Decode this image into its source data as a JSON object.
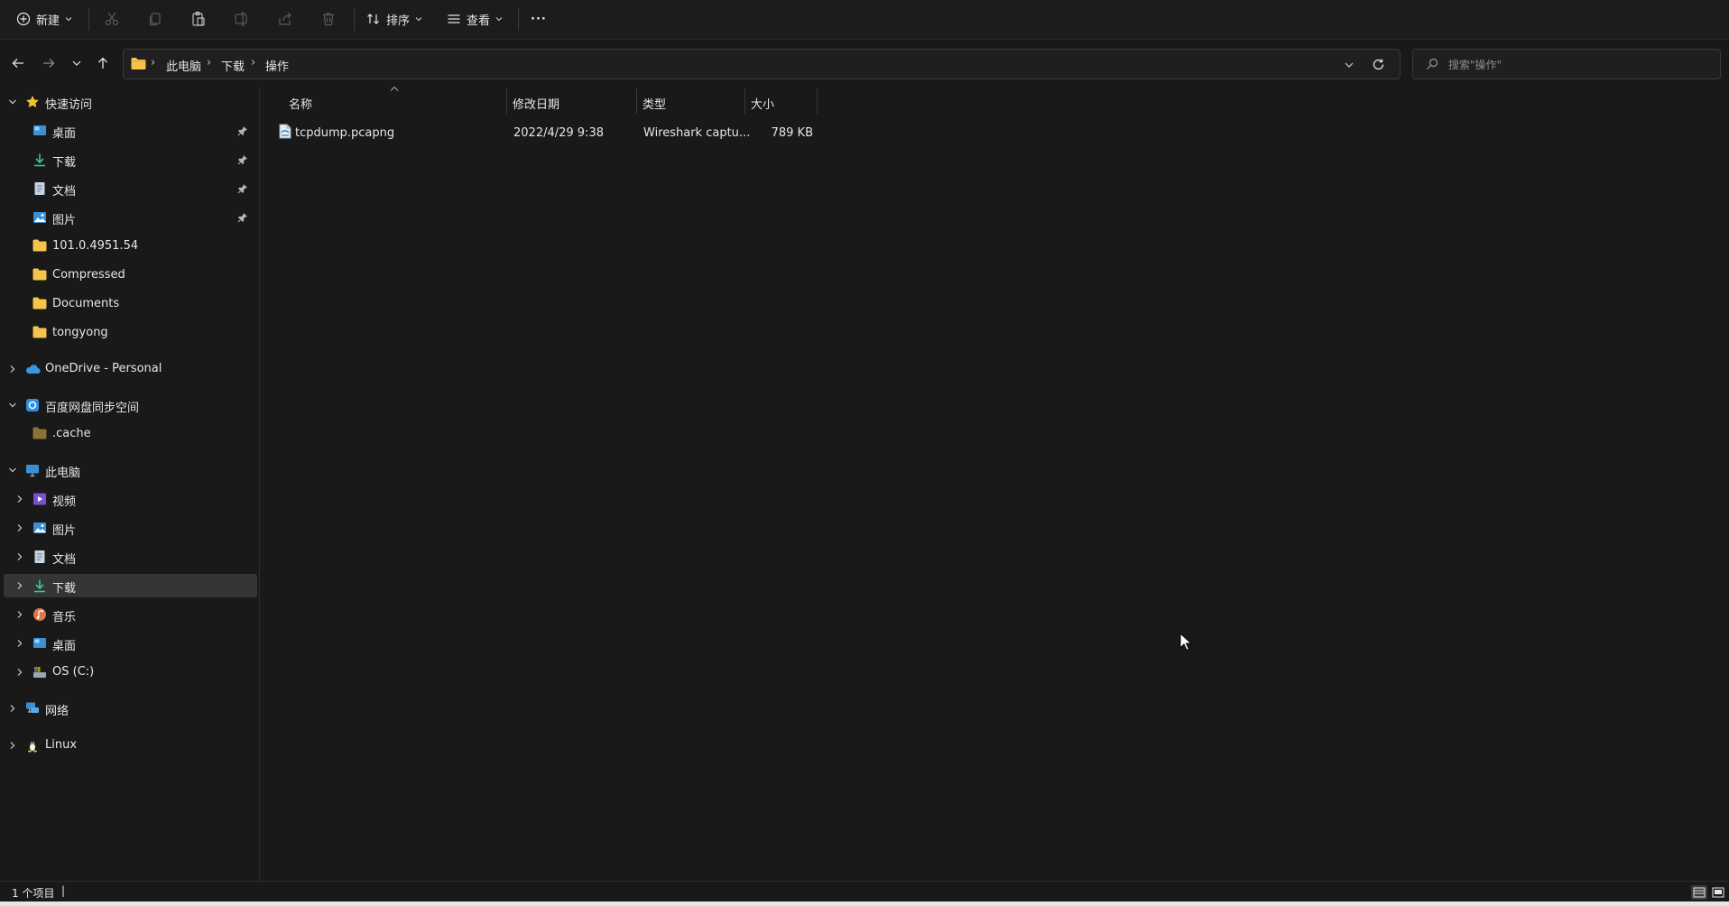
{
  "toolbar": {
    "new_label": "新建",
    "sort_label": "排序",
    "view_label": "查看",
    "more_label": "···"
  },
  "address": {
    "crumbs": [
      "此电脑",
      "下载",
      "操作"
    ],
    "search_placeholder": "搜索\"操作\""
  },
  "sidebar": {
    "quick_access": {
      "label": "快速访问",
      "items": [
        {
          "label": "桌面",
          "pinned": true,
          "icon": "desktop-icon"
        },
        {
          "label": "下载",
          "pinned": true,
          "icon": "download-icon"
        },
        {
          "label": "文档",
          "pinned": true,
          "icon": "document-icon"
        },
        {
          "label": "图片",
          "pinned": true,
          "icon": "picture-icon"
        },
        {
          "label": "101.0.4951.54",
          "pinned": false,
          "icon": "folder-icon"
        },
        {
          "label": "Compressed",
          "pinned": false,
          "icon": "folder-icon"
        },
        {
          "label": "Documents",
          "pinned": false,
          "icon": "folder-icon"
        },
        {
          "label": "tongyong",
          "pinned": false,
          "icon": "folder-icon"
        }
      ]
    },
    "onedrive": {
      "label": "OneDrive - Personal"
    },
    "baidu": {
      "label": "百度网盘同步空间",
      "items": [
        {
          "label": ".cache"
        }
      ]
    },
    "this_pc": {
      "label": "此电脑",
      "items": [
        {
          "label": "视频",
          "icon": "video-icon"
        },
        {
          "label": "图片",
          "icon": "picture-icon"
        },
        {
          "label": "文档",
          "icon": "document-icon"
        },
        {
          "label": "下载",
          "icon": "download-icon",
          "selected": true
        },
        {
          "label": "音乐",
          "icon": "music-icon"
        },
        {
          "label": "桌面",
          "icon": "desktop-icon"
        },
        {
          "label": "OS (C:)",
          "icon": "drive-icon"
        }
      ]
    },
    "network": {
      "label": "网络"
    },
    "linux": {
      "label": "Linux"
    }
  },
  "content": {
    "columns": {
      "name": "名称",
      "modified": "修改日期",
      "type": "类型",
      "size": "大小"
    },
    "files": [
      {
        "name": "tcpdump.pcapng",
        "modified": "2022/4/29 9:38",
        "type": "Wireshark captu...",
        "size": "789 KB"
      }
    ]
  },
  "status": {
    "item_count": "1 个项目",
    "separator": "|"
  },
  "colors": {
    "background": "#191919",
    "selected": "#353535",
    "folder": "#f4c54a",
    "accent_blue": "#4aa3e8",
    "download_green": "#3cc98b"
  }
}
